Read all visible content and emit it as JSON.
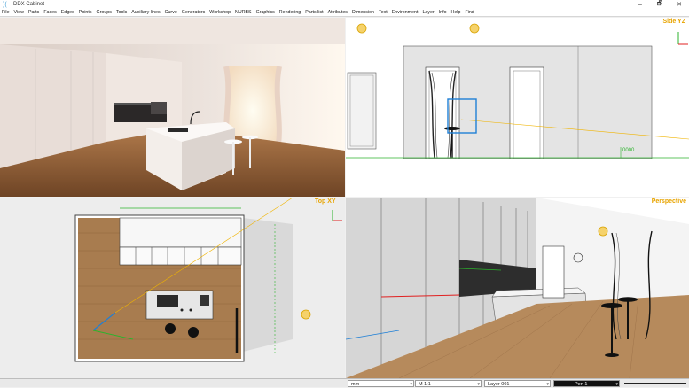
{
  "app": {
    "title": "DDX Cabinet",
    "logo_glyph": ")(",
    "window_buttons": [
      "–",
      "🗗",
      "✕"
    ]
  },
  "menu": [
    "File",
    "View",
    "Parts",
    "Faces",
    "Edges",
    "Points",
    "Groups",
    "Tools",
    "Auxiliary lines",
    "Curve",
    "Generators",
    "Workshop",
    "NURBS",
    "Graphics",
    "Rendering",
    "Parts list",
    "Attributes",
    "Dimension",
    "Text",
    "Environment",
    "Layer",
    "Info",
    "Help",
    "Find"
  ],
  "viewports": {
    "side": {
      "label": "Side  YZ",
      "dimension_text": "0000"
    },
    "top": {
      "label": "Top  XY"
    },
    "perspective": {
      "label": "Perspective"
    }
  },
  "statusbar": {
    "unit": "mm",
    "scale": "M 1:1",
    "layer": "Layer 001",
    "pen": "Pen 1"
  },
  "colors": {
    "accent": "#e8a400",
    "axis_green": "#2db32d",
    "select_blue": "#1e7fd6",
    "wood": "#a87c4f"
  }
}
